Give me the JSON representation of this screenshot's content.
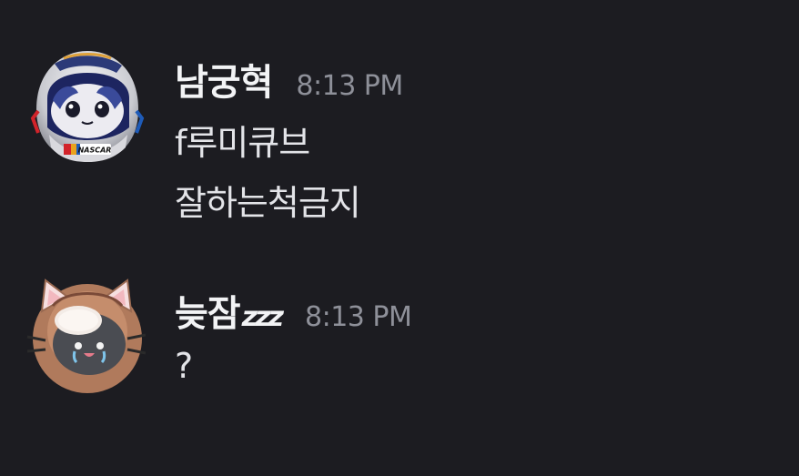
{
  "messages": [
    {
      "username": "남궁혁",
      "username_suffix": "",
      "timestamp": "8:13 PM",
      "lines": [
        "f루미큐브",
        "잘하는척금지"
      ],
      "avatar": {
        "icon": "nascar-helmet-avatar",
        "badge_text": "NASCAR"
      }
    },
    {
      "username": "늦잠",
      "username_suffix": "zzz",
      "timestamp": "8:13 PM",
      "lines": [
        "?"
      ],
      "avatar": {
        "icon": "cat-costume-avatar"
      }
    }
  ],
  "colors": {
    "background": "#1c1c21",
    "username": "#f2f3f5",
    "timestamp": "#8e9099",
    "message_text": "#e3e4e8"
  }
}
